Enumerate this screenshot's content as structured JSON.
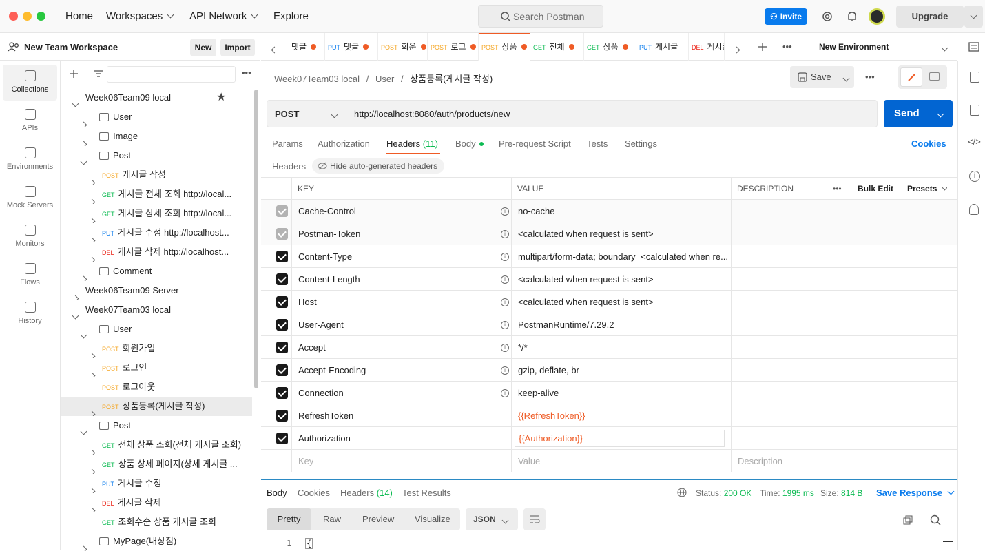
{
  "topbar": {
    "home": "Home",
    "workspaces": "Workspaces",
    "api_network": "API Network",
    "explore": "Explore",
    "search_placeholder": "Search Postman",
    "invite": "Invite",
    "upgrade": "Upgrade"
  },
  "workspace": {
    "name": "New Team Workspace",
    "new": "New",
    "import": "Import"
  },
  "rail": [
    {
      "label": "Collections"
    },
    {
      "label": "APIs"
    },
    {
      "label": "Environments"
    },
    {
      "label": "Mock Servers"
    },
    {
      "label": "Monitors"
    },
    {
      "label": "Flows"
    },
    {
      "label": "History"
    }
  ],
  "tree": [
    {
      "level": 0,
      "type": "collection",
      "label": "Week06Team09 local",
      "open": true
    },
    {
      "level": 1,
      "type": "folder",
      "label": "User"
    },
    {
      "level": 1,
      "type": "folder",
      "label": "Image"
    },
    {
      "level": 1,
      "type": "folder",
      "label": "Post",
      "open": true
    },
    {
      "level": 2,
      "method": "POST",
      "label": "게시글 작성"
    },
    {
      "level": 2,
      "method": "GET",
      "label": "게시글 전체 조회 http://local..."
    },
    {
      "level": 2,
      "method": "GET",
      "label": "게시글 상세 조회 http://local..."
    },
    {
      "level": 2,
      "method": "PUT",
      "label": "게시글 수정 http://localhost..."
    },
    {
      "level": 2,
      "method": "DEL",
      "label": "게시글 삭제 http://localhost..."
    },
    {
      "level": 1,
      "type": "folder",
      "label": "Comment"
    },
    {
      "level": 0,
      "type": "collection",
      "label": "Week06Team09 Server"
    },
    {
      "level": 0,
      "type": "collection",
      "label": "Week07Team03 local",
      "open": true
    },
    {
      "level": 1,
      "type": "folder",
      "label": "User",
      "open": true
    },
    {
      "level": 2,
      "method": "POST",
      "label": "회원가입"
    },
    {
      "level": 2,
      "method": "POST",
      "label": "로그인"
    },
    {
      "level": 2,
      "method": "POST",
      "label": "로그아웃",
      "noarrow": true
    },
    {
      "level": 2,
      "method": "POST",
      "label": "상품등록(게시글 작성)",
      "selected": true
    },
    {
      "level": 1,
      "type": "folder",
      "label": "Post",
      "open": true
    },
    {
      "level": 2,
      "method": "GET",
      "label": "전체 상품 조회(전체 게시글 조회)"
    },
    {
      "level": 2,
      "method": "GET",
      "label": "상품 상세 페이지(상세 게시글 ..."
    },
    {
      "level": 2,
      "method": "PUT",
      "label": "게시글 수정"
    },
    {
      "level": 2,
      "method": "DEL",
      "label": "게시글 삭제"
    },
    {
      "level": 2,
      "method": "GET",
      "label": "조회수순 상품 게시글 조회",
      "noarrow": true
    },
    {
      "level": 1,
      "type": "folder",
      "label": "MyPage(내상점)"
    }
  ],
  "tabs": [
    {
      "method": "",
      "label": "댓글"
    },
    {
      "method": "PUT",
      "label": "댓글"
    },
    {
      "method": "POST",
      "label": "회운"
    },
    {
      "method": "POST",
      "label": "로그"
    },
    {
      "method": "POST",
      "label": "상품",
      "active": true
    },
    {
      "method": "GET",
      "label": "전체"
    },
    {
      "method": "GET",
      "label": "상품"
    },
    {
      "method": "PUT",
      "label": "게시글"
    },
    {
      "method": "DEL",
      "label": "게시글"
    }
  ],
  "environment": "New Environment",
  "breadcrumb": {
    "collection": "Week07Team03 local",
    "folder": "User",
    "request": "상품등록(게시글 작성)"
  },
  "save": "Save",
  "request": {
    "method": "POST",
    "url": "http://localhost:8080/auth/products/new",
    "send": "Send"
  },
  "req_tabs": {
    "params": "Params",
    "authorization": "Authorization",
    "headers": "Headers",
    "headers_count": "(11)",
    "body": "Body",
    "prerequest": "Pre-request Script",
    "tests": "Tests",
    "settings": "Settings",
    "cookies": "Cookies"
  },
  "headers_bar": {
    "title": "Headers",
    "hide": "Hide auto-generated headers"
  },
  "table": {
    "key": "KEY",
    "value": "VALUE",
    "description": "DESCRIPTION",
    "bulk_edit": "Bulk Edit",
    "presets": "Presets",
    "key_ph": "Key",
    "value_ph": "Value",
    "desc_ph": "Description"
  },
  "headers": [
    {
      "key": "Cache-Control",
      "value": "no-cache",
      "auto": true,
      "info": true
    },
    {
      "key": "Postman-Token",
      "value": "<calculated when request is sent>",
      "auto": true,
      "info": true
    },
    {
      "key": "Content-Type",
      "value": "multipart/form-data; boundary=<calculated when re...",
      "info": true
    },
    {
      "key": "Content-Length",
      "value": "<calculated when request is sent>",
      "info": true
    },
    {
      "key": "Host",
      "value": "<calculated when request is sent>",
      "info": true
    },
    {
      "key": "User-Agent",
      "value": "PostmanRuntime/7.29.2",
      "info": true
    },
    {
      "key": "Accept",
      "value": "*/*",
      "info": true
    },
    {
      "key": "Accept-Encoding",
      "value": "gzip, deflate, br",
      "info": true
    },
    {
      "key": "Connection",
      "value": "keep-alive",
      "info": true
    },
    {
      "key": "RefreshToken",
      "value": "{{RefreshToken}}",
      "variable": true
    },
    {
      "key": "Authorization",
      "value": "{{Authorization}}",
      "variable": true,
      "editing": true
    }
  ],
  "response": {
    "body": "Body",
    "cookies": "Cookies",
    "headers": "Headers",
    "headers_count": "(14)",
    "test_results": "Test Results",
    "status_label": "Status:",
    "status": "200 OK",
    "time_label": "Time:",
    "time": "1995 ms",
    "size_label": "Size:",
    "size": "814 B",
    "save_response": "Save Response",
    "pretty": "Pretty",
    "raw": "Raw",
    "preview": "Preview",
    "visualize": "Visualize",
    "format": "JSON",
    "line_no": "1",
    "line_text": "{"
  },
  "colors": {
    "accent": "#ef5b25",
    "send": "#0265d2",
    "invite": "#097bed",
    "status_ok": "#0cbb52"
  }
}
